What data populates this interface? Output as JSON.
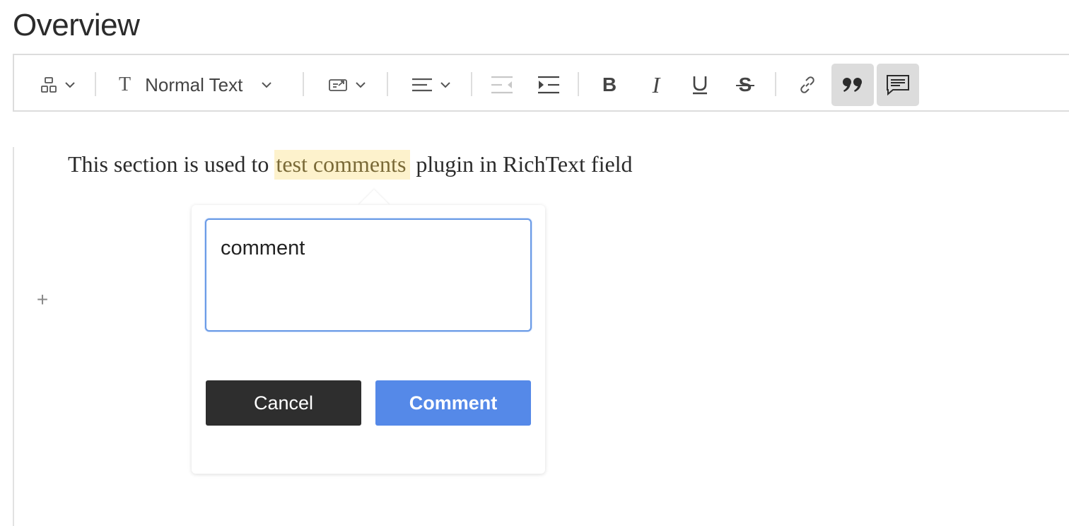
{
  "page": {
    "title": "Overview"
  },
  "toolbar": {
    "format_label": "Normal Text",
    "active_color": "#dcdcdc",
    "items": [
      {
        "name": "block-type",
        "icon": "blocks-icon",
        "dropdown": true
      },
      {
        "name": "text-format",
        "icon": "text-t-icon",
        "dropdown": true
      },
      {
        "name": "insert",
        "icon": "insert-embed-icon",
        "dropdown": true
      },
      {
        "name": "align",
        "icon": "align-left-icon",
        "dropdown": true
      },
      {
        "name": "outdent",
        "icon": "outdent-icon",
        "disabled": true
      },
      {
        "name": "indent",
        "icon": "indent-icon"
      },
      {
        "name": "bold",
        "icon": "bold-icon"
      },
      {
        "name": "italic",
        "icon": "italic-icon"
      },
      {
        "name": "underline",
        "icon": "underline-icon"
      },
      {
        "name": "strikethrough",
        "icon": "strikethrough-icon"
      },
      {
        "name": "link",
        "icon": "link-icon"
      },
      {
        "name": "blockquote",
        "icon": "quote-icon",
        "active": true
      },
      {
        "name": "comment",
        "icon": "comment-icon",
        "active": true
      }
    ]
  },
  "editor": {
    "text_before": "This section is used to ",
    "text_highlight": "test comments",
    "text_after": " plugin in RichText field",
    "highlight_color": "#fdf2cc",
    "add_block_icon": "plus-icon"
  },
  "comment_popover": {
    "input_value": "comment",
    "cancel_label": "Cancel",
    "submit_label": "Comment",
    "cancel_color": "#2e2e2e",
    "submit_color": "#5589e8"
  }
}
